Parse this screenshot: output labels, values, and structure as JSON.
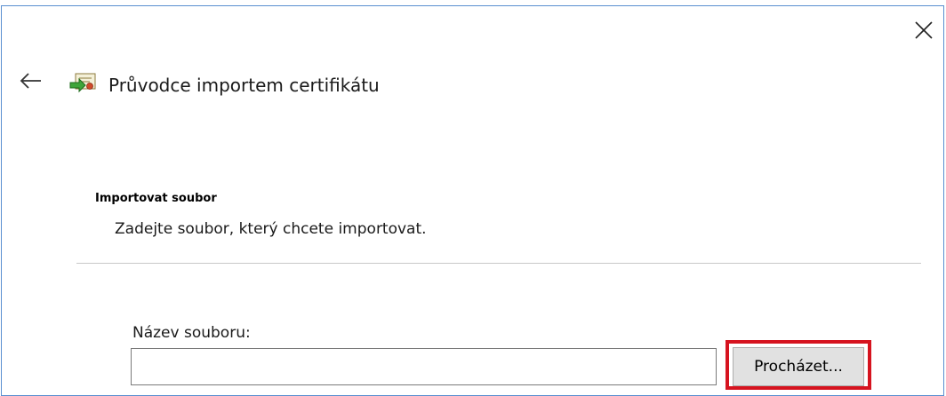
{
  "wizard": {
    "title": "Průvodce importem certifikátu",
    "icon": "certificate-wizard-icon"
  },
  "window": {
    "close_icon": "close-icon",
    "back_icon": "back-arrow-icon"
  },
  "section": {
    "heading": "Importovat soubor",
    "description": "Zadejte soubor, který chcete importovat."
  },
  "file_field": {
    "label": "Název souboru:",
    "value": "",
    "placeholder": ""
  },
  "browse_button": {
    "label": "Procházet..."
  },
  "colors": {
    "window_border": "#5a8fd0",
    "highlight": "#d6131f",
    "button_face": "#e1e1e1"
  }
}
